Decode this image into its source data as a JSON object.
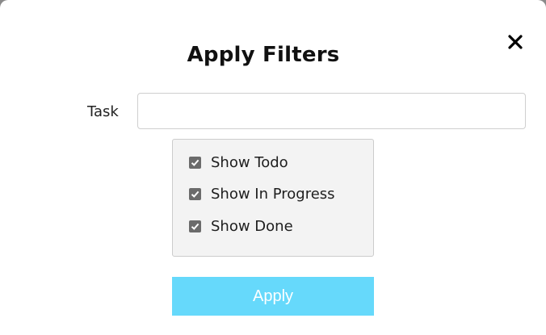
{
  "modal": {
    "title": "Apply Filters",
    "close_icon": "close-icon"
  },
  "task": {
    "label": "Task",
    "value": "",
    "placeholder": ""
  },
  "statuses": [
    {
      "label": "Show Todo",
      "checked": true
    },
    {
      "label": "Show In Progress",
      "checked": true
    },
    {
      "label": "Show Done",
      "checked": true
    }
  ],
  "apply_button": {
    "label": "Apply"
  },
  "colors": {
    "apply_bg": "#66d9fb",
    "checkbox": "#6b6b6b",
    "status_panel_bg": "#f3f3f3"
  }
}
